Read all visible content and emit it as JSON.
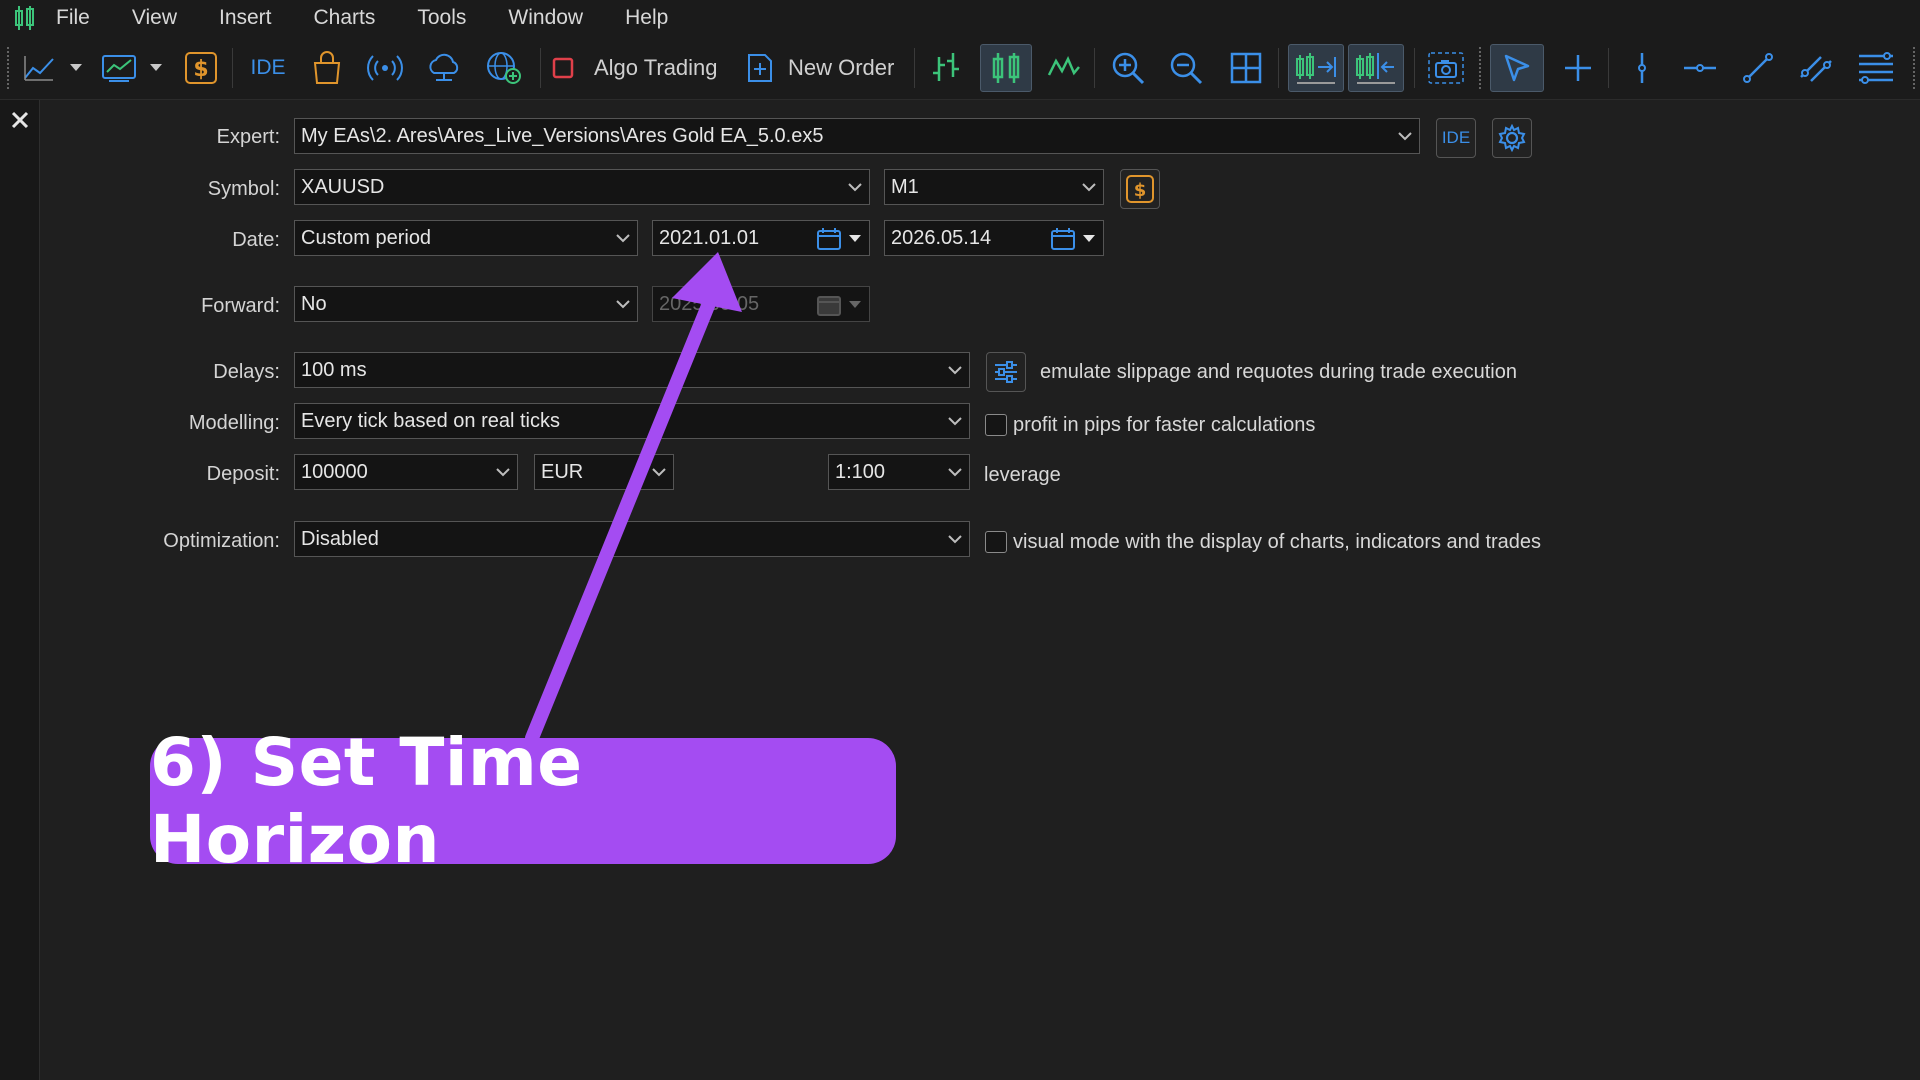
{
  "menu": [
    "File",
    "View",
    "Insert",
    "Charts",
    "Tools",
    "Window",
    "Help"
  ],
  "toolbar": {
    "ide_label": "IDE",
    "algo_trading_label": "Algo Trading",
    "new_order_label": "New Order"
  },
  "form": {
    "expert": {
      "label": "Expert:",
      "value": "My EAs\\2. Ares\\Ares_Live_Versions\\Ares Gold EA_5.0.ex5",
      "ide_label": "IDE"
    },
    "symbol": {
      "label": "Symbol:",
      "value": "XAUUSD",
      "timeframe": "M1"
    },
    "date": {
      "label": "Date:",
      "mode": "Custom period",
      "from": "2021.01.01",
      "to": "2026.05.14"
    },
    "forward": {
      "label": "Forward:",
      "value": "No",
      "date": "2025.09.05"
    },
    "delays": {
      "label": "Delays:",
      "value": "100 ms",
      "note": "emulate slippage and requotes during trade execution"
    },
    "modelling": {
      "label": "Modelling:",
      "value": "Every tick based on real ticks",
      "checkbox_label": "profit in pips for faster calculations",
      "checked": false
    },
    "deposit": {
      "label": "Deposit:",
      "amount": "100000",
      "currency": "EUR",
      "leverage": "1:100",
      "leverage_label": "leverage"
    },
    "optimization": {
      "label": "Optimization:",
      "value": "Disabled",
      "checkbox_label": "visual mode with the display of charts, indicators and trades",
      "checked": false
    }
  },
  "annotation": {
    "text": "6) Set Time Horizon",
    "color": "#a44cf2"
  },
  "colors": {
    "accent_blue": "#3b8fe8",
    "accent_green": "#3cc47a",
    "accent_orange": "#e0952c",
    "stop_red": "#e0404a"
  }
}
